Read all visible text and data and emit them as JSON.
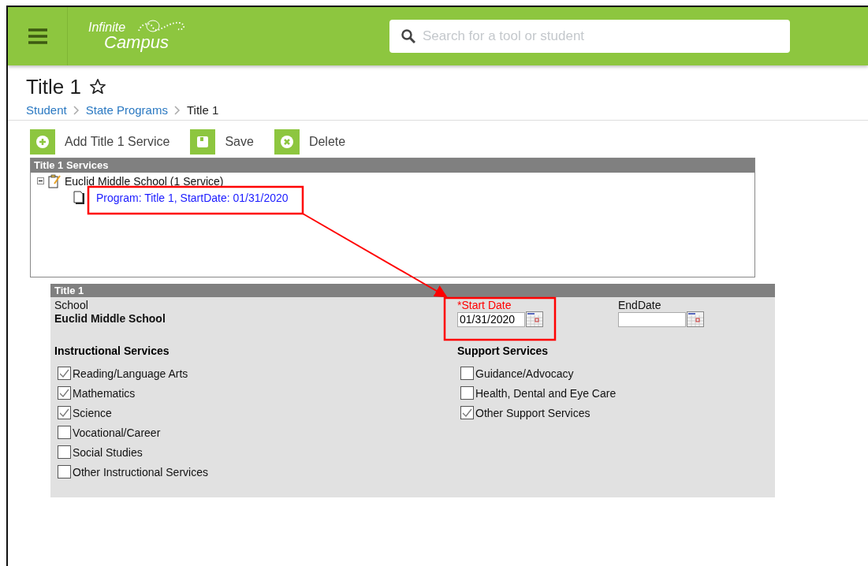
{
  "header": {
    "logo": [
      "Infinite",
      "Campus"
    ],
    "search": {
      "placeholder": "Search for a tool or student"
    }
  },
  "page": {
    "title": "Title 1",
    "favorite": false,
    "breadcrumb": [
      {
        "label": "Student",
        "link": true
      },
      {
        "label": "State Programs",
        "link": true
      },
      {
        "label": "Title 1",
        "link": false
      }
    ]
  },
  "toolbar": [
    {
      "kind": "add",
      "label": "Add Title 1 Service"
    },
    {
      "kind": "save",
      "label": "Save"
    },
    {
      "kind": "delete",
      "label": "Delete"
    }
  ],
  "services_panel": {
    "title": "Title 1 Services",
    "tree": [
      {
        "label": "Euclid Middle School (1 Service)",
        "expanded": true,
        "children": [
          {
            "label": "Program: Title 1, StartDate: 01/31/2020"
          }
        ]
      }
    ]
  },
  "form": {
    "title": "Title 1",
    "school_label": "School",
    "school": "Euclid Middle School",
    "start_date": {
      "label": "*Start Date",
      "value": "01/31/2020"
    },
    "end_date": {
      "label": "EndDate"
    },
    "instructional": {
      "title": "Instructional Services",
      "items": [
        {
          "label": "Reading/Language Arts",
          "checked": true
        },
        {
          "label": "Mathematics",
          "checked": true
        },
        {
          "label": "Science",
          "checked": true
        },
        {
          "label": "Vocational/Career",
          "checked": false
        },
        {
          "label": "Social Studies",
          "checked": false
        },
        {
          "label": "Other Instructional Services",
          "checked": false
        }
      ]
    },
    "support": {
      "title": "Support Services",
      "items": [
        {
          "label": "Guidance/Advocacy",
          "checked": false
        },
        {
          "label": "Health, Dental and Eye Care",
          "checked": false
        },
        {
          "label": "Other Support Services",
          "checked": true
        }
      ]
    }
  }
}
